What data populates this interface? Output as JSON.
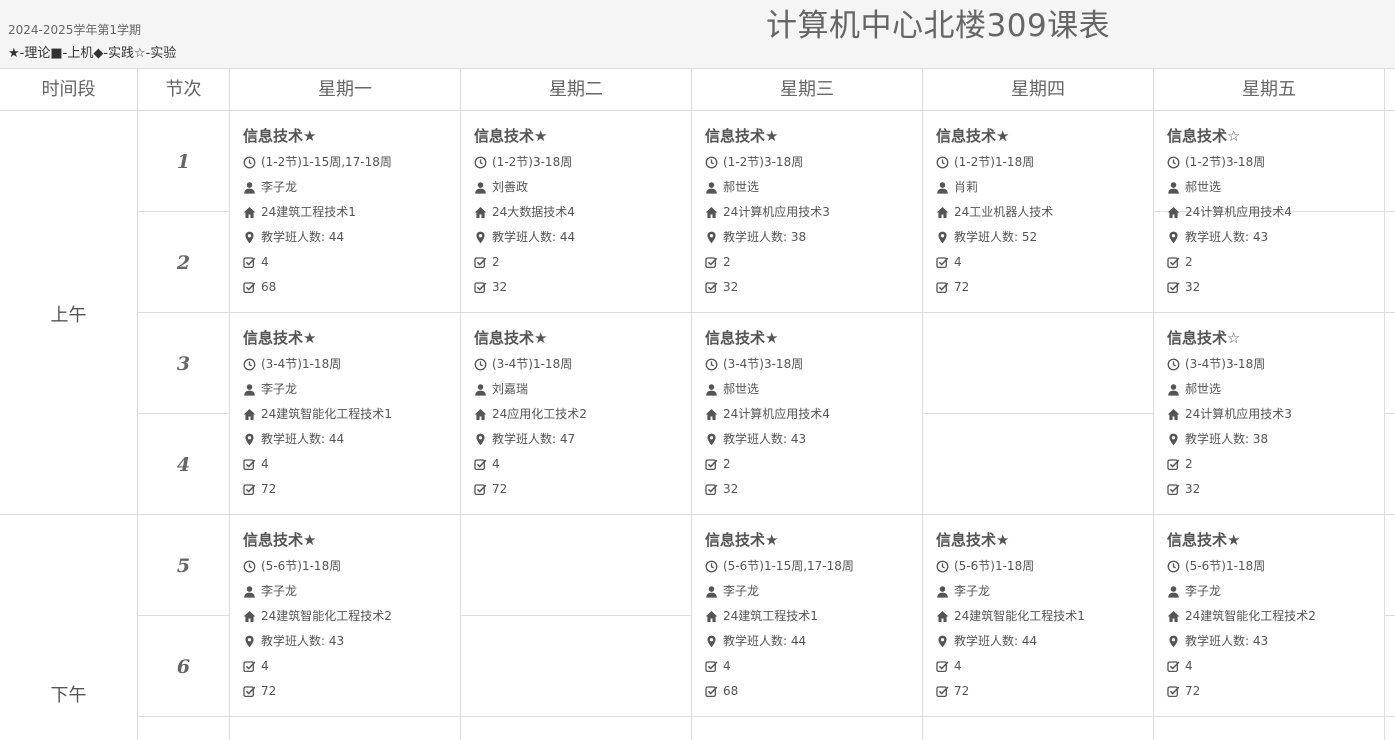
{
  "header": {
    "semester": "2024-2025学年第1学期",
    "legend": "★-理论■-上机◆-实践☆-实验",
    "title": "计算机中心北楼309课表"
  },
  "columns": {
    "time": "时间段",
    "slot": "节次",
    "days": [
      "星期一",
      "星期二",
      "星期三",
      "星期四",
      "星期五"
    ]
  },
  "periods": {
    "morning": "上午",
    "afternoon": "下午"
  },
  "slots": [
    "1",
    "2",
    "3",
    "4",
    "5",
    "6"
  ],
  "courses": {
    "mon_12": {
      "name": "信息技术★",
      "weeks": "(1-2节)1-15周,17-18周",
      "teacher": "李子龙",
      "class": "24建筑工程技术1",
      "count": "教学班人数: 44",
      "v1": "4",
      "v2": "68"
    },
    "tue_12": {
      "name": "信息技术★",
      "weeks": "(1-2节)3-18周",
      "teacher": "刘善政",
      "class": "24大数据技术4",
      "count": "教学班人数: 44",
      "v1": "2",
      "v2": "32"
    },
    "wed_12": {
      "name": "信息技术★",
      "weeks": "(1-2节)3-18周",
      "teacher": "郝世选",
      "class": "24计算机应用技术3",
      "count": "教学班人数: 38",
      "v1": "2",
      "v2": "32"
    },
    "thu_12": {
      "name": "信息技术★",
      "weeks": "(1-2节)1-18周",
      "teacher": "肖莉",
      "class": "24工业机器人技术",
      "count": "教学班人数: 52",
      "v1": "4",
      "v2": "72"
    },
    "fri_12": {
      "name": "信息技术☆",
      "weeks": "(1-2节)3-18周",
      "teacher": "郝世选",
      "class": "24计算机应用技术4",
      "count": "教学班人数: 43",
      "v1": "2",
      "v2": "32"
    },
    "mon_34": {
      "name": "信息技术★",
      "weeks": "(3-4节)1-18周",
      "teacher": "李子龙",
      "class": "24建筑智能化工程技术1",
      "count": "教学班人数: 44",
      "v1": "4",
      "v2": "72"
    },
    "tue_34": {
      "name": "信息技术★",
      "weeks": "(3-4节)1-18周",
      "teacher": "刘嘉瑞",
      "class": "24应用化工技术2",
      "count": "教学班人数: 47",
      "v1": "4",
      "v2": "72"
    },
    "wed_34": {
      "name": "信息技术★",
      "weeks": "(3-4节)3-18周",
      "teacher": "郝世选",
      "class": "24计算机应用技术4",
      "count": "教学班人数: 43",
      "v1": "2",
      "v2": "32"
    },
    "fri_34": {
      "name": "信息技术☆",
      "weeks": "(3-4节)3-18周",
      "teacher": "郝世选",
      "class": "24计算机应用技术3",
      "count": "教学班人数: 38",
      "v1": "2",
      "v2": "32"
    },
    "mon_56": {
      "name": "信息技术★",
      "weeks": "(5-6节)1-18周",
      "teacher": "李子龙",
      "class": "24建筑智能化工程技术2",
      "count": "教学班人数: 43",
      "v1": "4",
      "v2": "72"
    },
    "wed_56": {
      "name": "信息技术★",
      "weeks": "(5-6节)1-15周,17-18周",
      "teacher": "李子龙",
      "class": "24建筑工程技术1",
      "count": "教学班人数: 44",
      "v1": "4",
      "v2": "68"
    },
    "thu_56": {
      "name": "信息技术★",
      "weeks": "(5-6节)1-18周",
      "teacher": "李子龙",
      "class": "24建筑智能化工程技术1",
      "count": "教学班人数: 44",
      "v1": "4",
      "v2": "72"
    },
    "fri_56": {
      "name": "信息技术★",
      "weeks": "(5-6节)1-18周",
      "teacher": "李子龙",
      "class": "24建筑智能化工程技术2",
      "count": "教学班人数: 43",
      "v1": "4",
      "v2": "72"
    }
  },
  "icons": [
    "clock-icon",
    "user-icon",
    "home-icon",
    "location-pin-icon",
    "checkbox-icon"
  ]
}
